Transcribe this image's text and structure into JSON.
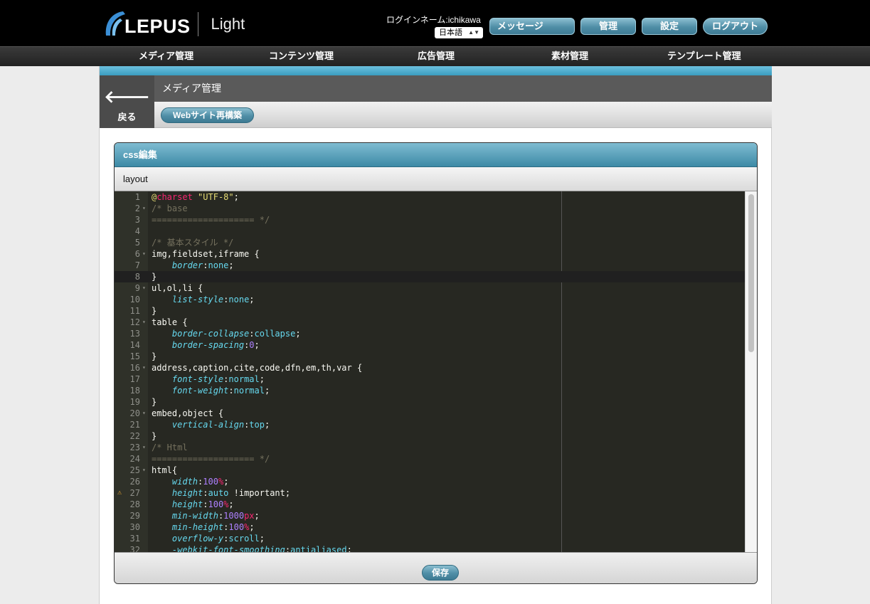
{
  "header": {
    "logo_text": "LEPUS",
    "logo_sub": "Light",
    "login_name": "ログインネーム:ichikawa",
    "language": "日本語",
    "buttons": {
      "message": "メッセージ",
      "admin": "管理",
      "settings": "設定",
      "logout": "ログアウト"
    }
  },
  "nav": {
    "items": [
      "メディア管理",
      "コンテンツ管理",
      "広告管理",
      "素材管理",
      "テンプレート管理"
    ]
  },
  "page": {
    "back_label": "戻る",
    "title": "メディア管理",
    "rebuild_button": "Webサイト再構築"
  },
  "panel": {
    "title": "css編集",
    "file_name": "layout",
    "save_button": "保存",
    "active_line": 8,
    "warning_line": 27,
    "code_lines": [
      "@charset \"UTF-8\";",
      "/* base",
      "==================== */",
      "",
      "/* 基本スタイル */",
      "img,fieldset,iframe {",
      "    border:none;",
      "}",
      "ul,ol,li {",
      "    list-style:none;",
      "}",
      "table {",
      "    border-collapse:collapse;",
      "    border-spacing:0;",
      "}",
      "address,caption,cite,code,dfn,em,th,var {",
      "    font-style:normal;",
      "    font-weight:normal;",
      "}",
      "embed,object {",
      "    vertical-align:top;",
      "}",
      "/* Html",
      "==================== */",
      "html{",
      "    width:100%;",
      "    height:auto !important;",
      "    height:100%;",
      "    min-width:1000px;",
      "    min-height:100%;",
      "    overflow-y:scroll;",
      "    -webkit-font-smoothing:antialiased;"
    ],
    "fold_lines": [
      2,
      6,
      9,
      12,
      16,
      20,
      23,
      25
    ]
  },
  "colors": {
    "accent": "#4f8ea6",
    "editor_bg": "#272822"
  }
}
